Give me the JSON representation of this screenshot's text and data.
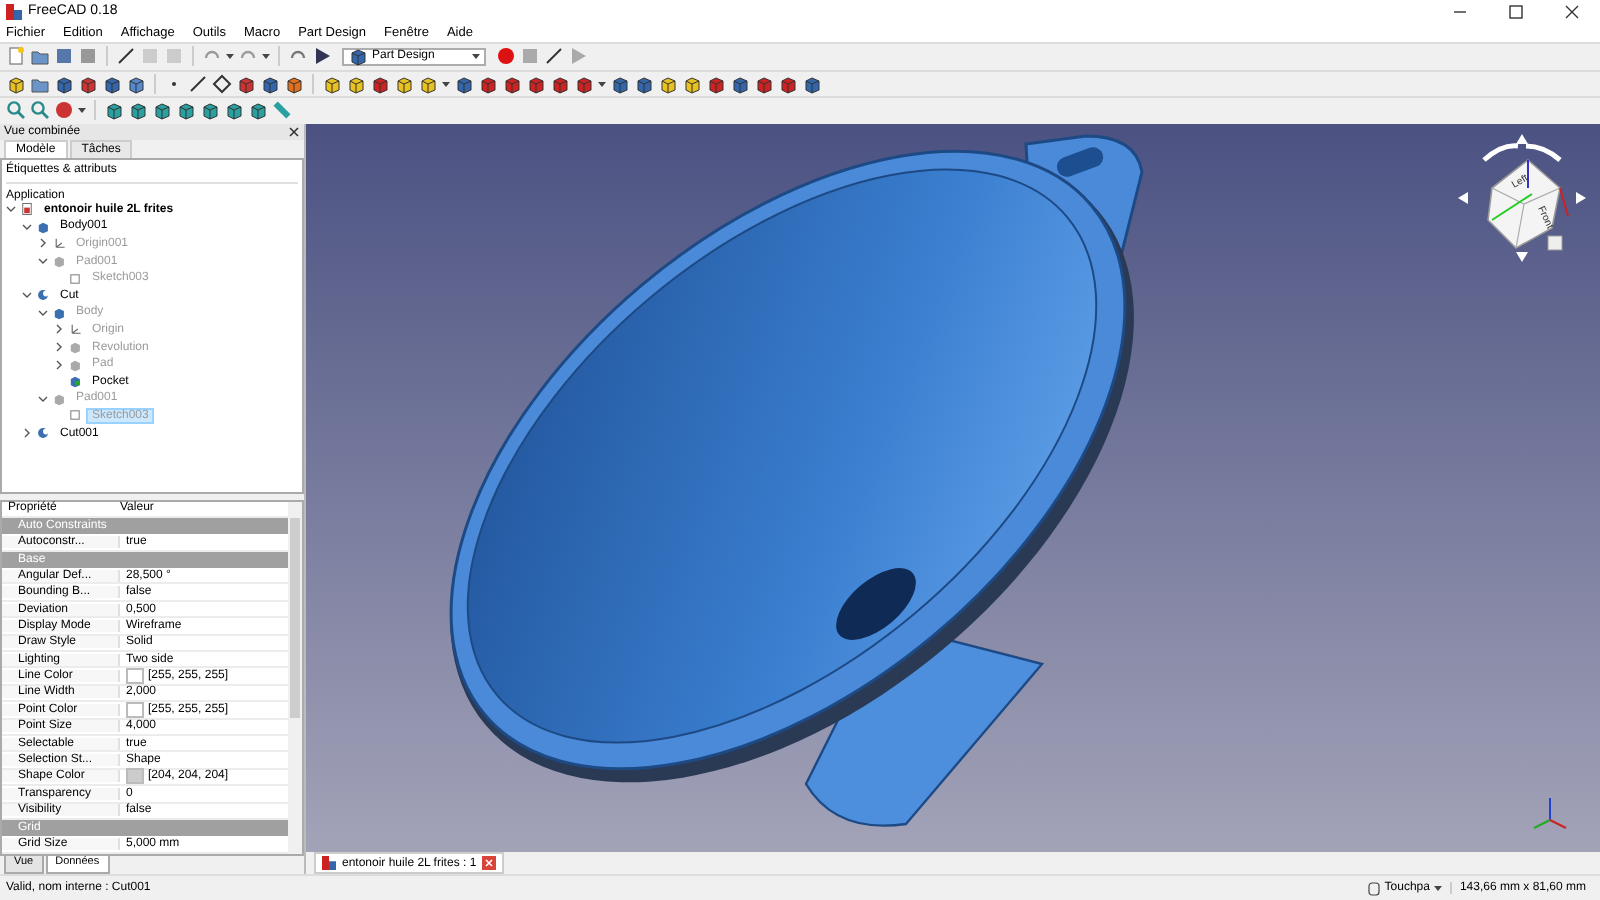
{
  "window": {
    "title": "FreeCAD 0.18"
  },
  "menu": [
    "Fichier",
    "Edition",
    "Affichage",
    "Outils",
    "Macro",
    "Part Design",
    "Fenêtre",
    "Aide"
  ],
  "workbench": {
    "value": "Part Design"
  },
  "combo_view": {
    "title": "Vue combinée"
  },
  "tabs": [
    {
      "label": "Modèle",
      "selected": true
    },
    {
      "label": "Tâches",
      "selected": false
    }
  ],
  "tree": {
    "header": "Étiquettes & attributs",
    "root": "Application",
    "items": [
      {
        "label": "entonoir huile 2L frites",
        "kind": "document",
        "expanded": true,
        "hidden": false,
        "selected": false,
        "children": [
          {
            "label": "Body001",
            "kind": "body",
            "expanded": true,
            "hidden": false,
            "selected": false,
            "children": [
              {
                "label": "Origin001",
                "kind": "origin",
                "expanded": false,
                "hidden": true,
                "selected": false
              },
              {
                "label": "Pad001",
                "kind": "pad",
                "expanded": true,
                "hidden": true,
                "selected": false,
                "children": [
                  {
                    "label": "Sketch003",
                    "kind": "sketch",
                    "hidden": true,
                    "selected": false
                  }
                ]
              }
            ]
          },
          {
            "label": "Cut",
            "kind": "cut",
            "expanded": true,
            "hidden": false,
            "selected": false,
            "children": [
              {
                "label": "Body",
                "kind": "body",
                "expanded": true,
                "hidden": true,
                "selected": false,
                "children": [
                  {
                    "label": "Origin",
                    "kind": "origin",
                    "expanded": false,
                    "hidden": true,
                    "selected": false
                  },
                  {
                    "label": "Revolution",
                    "kind": "pad",
                    "expanded": false,
                    "hidden": true,
                    "selected": false
                  },
                  {
                    "label": "Pad",
                    "kind": "pad",
                    "expanded": false,
                    "hidden": true,
                    "selected": false
                  },
                  {
                    "label": "Pocket",
                    "kind": "pocket",
                    "hidden": false,
                    "selected": false
                  }
                ]
              },
              {
                "label": "Pad001",
                "kind": "pad",
                "expanded": true,
                "hidden": true,
                "selected": false,
                "children": [
                  {
                    "label": "Sketch003",
                    "kind": "sketch",
                    "hidden": true,
                    "selected": true
                  }
                ]
              }
            ]
          },
          {
            "label": "Cut001",
            "kind": "cut",
            "expanded": false,
            "hidden": false,
            "selected": false
          }
        ]
      }
    ]
  },
  "properties": {
    "columns": [
      "Propriété",
      "Valeur"
    ],
    "rows": [
      {
        "kind": "group",
        "label": "Auto Constraints"
      },
      {
        "kind": "prop",
        "name": "Autoconstr...",
        "value": "true"
      },
      {
        "kind": "group",
        "label": "Base"
      },
      {
        "kind": "prop",
        "name": "Angular Def...",
        "value": "28,500 °"
      },
      {
        "kind": "prop",
        "name": "Bounding B...",
        "value": "false"
      },
      {
        "kind": "prop",
        "name": "Deviation",
        "value": "0,500"
      },
      {
        "kind": "prop",
        "name": "Display Mode",
        "value": "Wireframe"
      },
      {
        "kind": "prop",
        "name": "Draw Style",
        "value": "Solid"
      },
      {
        "kind": "prop",
        "name": "Lighting",
        "value": "Two side"
      },
      {
        "kind": "prop",
        "name": "Line Color",
        "value": "[255, 255, 255]",
        "color": "#ffffff"
      },
      {
        "kind": "prop",
        "name": "Line Width",
        "value": "2,000"
      },
      {
        "kind": "prop",
        "name": "Point Color",
        "value": "[255, 255, 255]",
        "color": "#ffffff"
      },
      {
        "kind": "prop",
        "name": "Point Size",
        "value": "4,000"
      },
      {
        "kind": "prop",
        "name": "Selectable",
        "value": "true"
      },
      {
        "kind": "prop",
        "name": "Selection St...",
        "value": "Shape"
      },
      {
        "kind": "prop",
        "name": "Shape Color",
        "value": "[204, 204, 204]",
        "color": "#cccccc"
      },
      {
        "kind": "prop",
        "name": "Transparency",
        "value": "0"
      },
      {
        "kind": "prop",
        "name": "Visibility",
        "value": "false"
      },
      {
        "kind": "group",
        "label": "Grid"
      },
      {
        "kind": "prop",
        "name": "Grid Size",
        "value": "5,000 mm"
      }
    ]
  },
  "property_tabs": [
    {
      "label": "Vue",
      "selected": false
    },
    {
      "label": "Données",
      "selected": true
    }
  ],
  "navcube": {
    "faces": [
      "Left",
      "Front"
    ]
  },
  "document_tab": {
    "label": "entonoir huile 2L frites : 1"
  },
  "status_bar": {
    "message": "Valid, nom interne : Cut001",
    "navigation": "Touchpa",
    "dimensions": "143,66 mm x 81,60 mm"
  }
}
